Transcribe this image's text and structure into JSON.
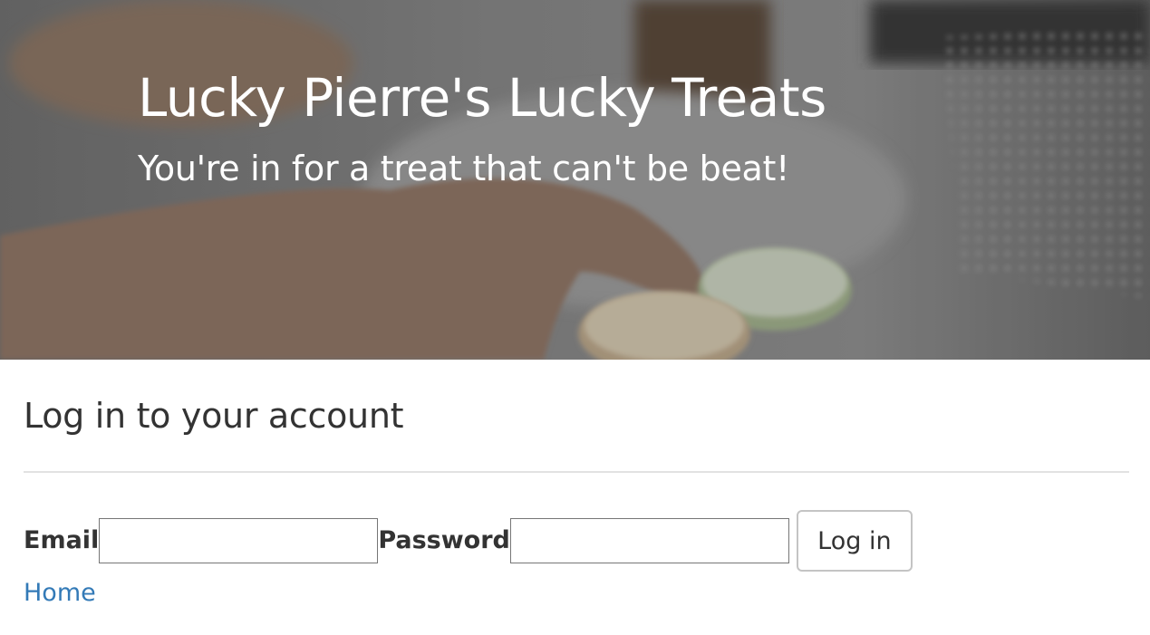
{
  "hero": {
    "title": "Lucky Pierre's Lucky Treats",
    "subtitle": "You're in for a treat that can't be beat!"
  },
  "login": {
    "heading": "Log in to your account",
    "email_label": "Email",
    "email_value": "",
    "password_label": "Password",
    "password_value": "",
    "submit_label": "Log in"
  },
  "nav": {
    "home_link": "Home"
  },
  "colors": {
    "link": "#337ab7",
    "text": "#333333",
    "hero_text": "#ffffff"
  }
}
